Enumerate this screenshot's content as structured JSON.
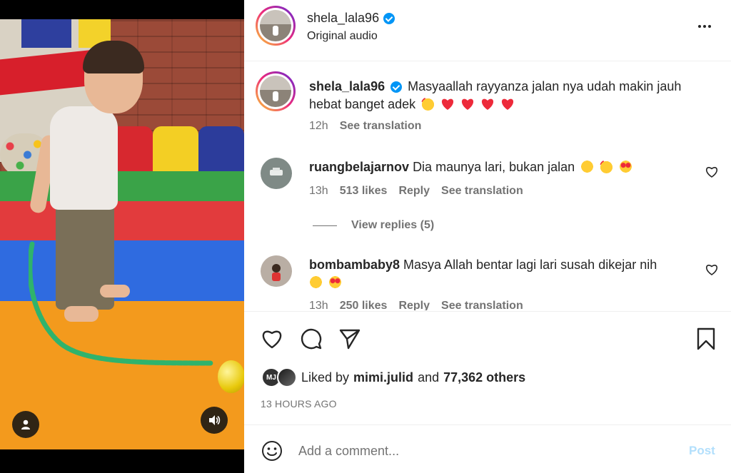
{
  "media": {
    "user_tag_icon": "person-icon",
    "mute_icon": "speaker-icon"
  },
  "header": {
    "username": "shela_lala96",
    "subtitle": "Original audio",
    "more_icon": "ellipsis-icon"
  },
  "caption": {
    "username": "shela_lala96",
    "text_line1": "Masyaallah rayyanza jalan nya udah makin jauh",
    "text_line2": "hebat banget adek",
    "time": "12h",
    "see_translation": "See translation"
  },
  "comments": [
    {
      "username": "ruangbelajarnov",
      "text": "Dia maunya lari, bukan jalan",
      "time": "13h",
      "likes": "513 likes",
      "reply": "Reply",
      "see_translation": "See translation",
      "view_replies": "View replies (5)"
    },
    {
      "username": "bombambaby8",
      "text": "Masya Allah bentar lagi lari susah dikejar nih",
      "time": "13h",
      "likes": "250 likes",
      "reply": "Reply",
      "see_translation": "See translation"
    }
  ],
  "actions": {
    "like_icon": "heart-icon",
    "comment_icon": "comment-icon",
    "share_icon": "send-icon",
    "save_icon": "bookmark-icon"
  },
  "likes": {
    "prefix": "Liked by",
    "user": "mimi.julid",
    "middle": "and",
    "count": "77,362 others",
    "avatar_initials": "MJ"
  },
  "timestamp": "13 HOURS AGO",
  "add_comment": {
    "placeholder": "Add a comment...",
    "post_label": "Post"
  },
  "colors": {
    "verified": "#0095f6",
    "post_disabled": "#b2dffc",
    "heart_red": "#ed2a3a"
  }
}
